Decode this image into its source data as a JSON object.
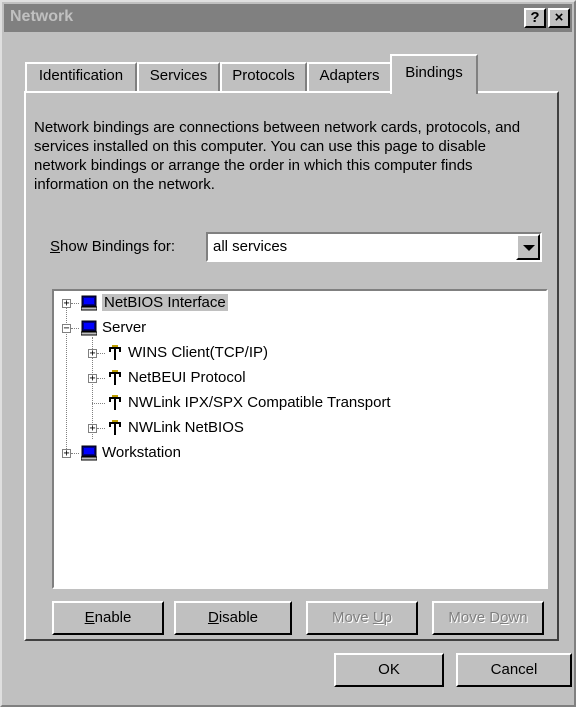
{
  "window": {
    "title": "Network",
    "help": "?",
    "close": "×"
  },
  "tabs": [
    "Identification",
    "Services",
    "Protocols",
    "Adapters",
    "Bindings"
  ],
  "active_tab": "Bindings",
  "description": "Network bindings are connections between network cards, protocols, and services installed on this computer.  You can use this page to disable network bindings or arrange the order in which this computer finds information on the network.",
  "show_bindings": {
    "label": "Show Bindings for:",
    "value": "all services"
  },
  "tree": [
    {
      "label": "NetBIOS Interface",
      "selected": true,
      "icon": "computer-icon"
    },
    {
      "label": "Server",
      "icon": "computer-icon"
    },
    {
      "label": "WINS Client(TCP/IP)",
      "icon": "network-protocol-icon"
    },
    {
      "label": "NetBEUI Protocol",
      "icon": "network-protocol-icon"
    },
    {
      "label": "NWLink IPX/SPX Compatible Transport",
      "icon": "network-protocol-icon"
    },
    {
      "label": "NWLink NetBIOS",
      "icon": "network-protocol-icon"
    },
    {
      "label": "Workstation",
      "icon": "computer-icon"
    }
  ],
  "buttons": {
    "enable": "Enable",
    "disable": "Disable",
    "move_up": "Move Up",
    "move_down": "Move Down"
  },
  "footer": {
    "ok": "OK",
    "cancel": "Cancel"
  },
  "colors": {
    "face": "#c0c0c0",
    "title_inactive": "#808080"
  }
}
